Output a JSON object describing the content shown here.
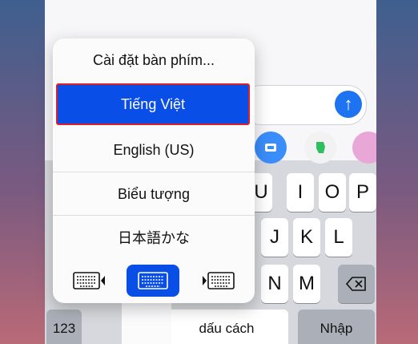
{
  "menu": {
    "items": [
      {
        "label": "Cài đặt bàn phím..."
      },
      {
        "label": "Tiếng Việt"
      },
      {
        "label": "English (US)"
      },
      {
        "label": "Biểu tượng"
      },
      {
        "label": "日本語かな"
      }
    ],
    "keyboard_buttons": [
      {
        "icon": "keyboard-left-icon"
      },
      {
        "icon": "keyboard-full-icon"
      },
      {
        "icon": "keyboard-right-icon"
      }
    ]
  },
  "keys": {
    "row1": [
      "U",
      "I",
      "O",
      "P"
    ],
    "row2": [
      "J",
      "K",
      "L"
    ],
    "row3": [
      "N",
      "M"
    ],
    "numbers": "123",
    "space": "dấu cách",
    "return": "Nhập"
  },
  "send_icon": "↑",
  "colors": {
    "selected": "#0a4ee8",
    "highlight_border": "#d8202c",
    "send": "#1e74f0"
  }
}
